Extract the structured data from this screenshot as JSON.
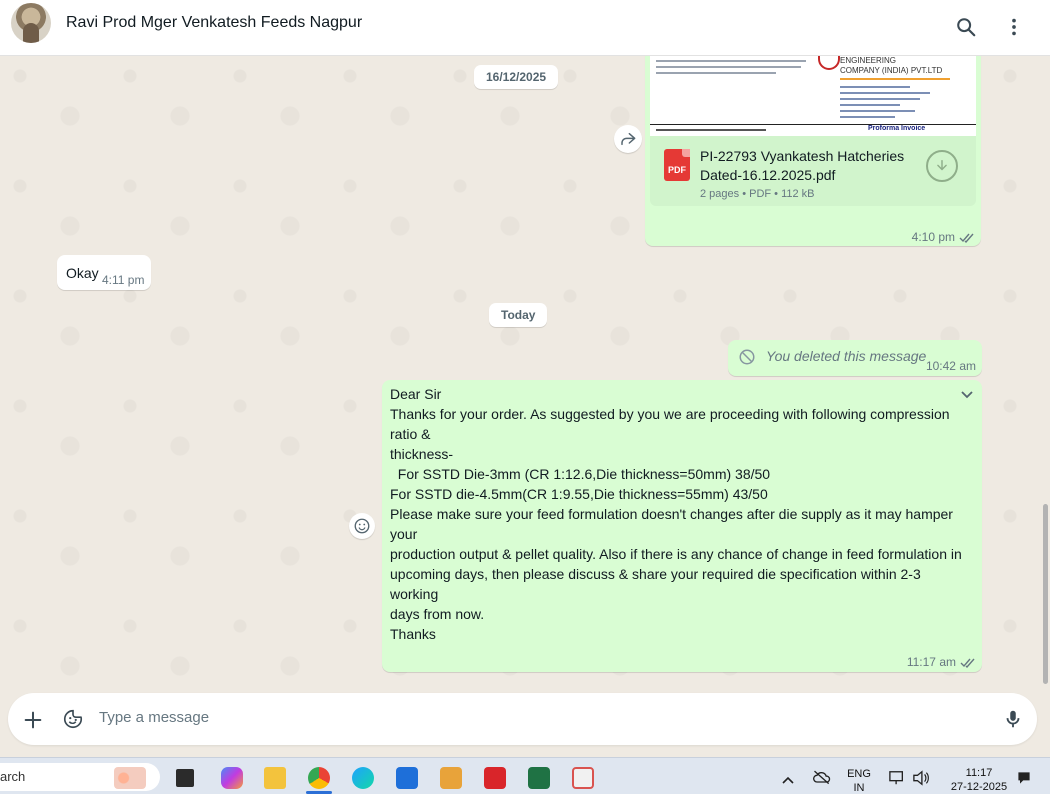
{
  "header": {
    "title": "Ravi Prod Mger Venkatesh Feeds Nagpur",
    "search_icon": "search-icon",
    "menu_icon": "more-vertical-icon"
  },
  "chat": {
    "date_1": "16/12/2025",
    "date_2": "Today",
    "doc_message": {
      "preview_company_line1": "ENGINEERING",
      "preview_company_line2": "COMPANY (INDIA) PVT.LTD",
      "preview_label": "Proforma Invoice",
      "file_name": "PI-22793 Vyankatesh Hatcheries Dated-16.12.2025.pdf",
      "file_info": "2 pages • PDF • 112 kB",
      "pdf_label": "PDF",
      "time": "4:10 pm"
    },
    "okay_message": {
      "text": "Okay",
      "time": "4:11 pm"
    },
    "deleted_message": {
      "text": "You deleted this message",
      "time": "10:42 am"
    },
    "long_message": {
      "lines": [
        "Dear Sir",
        "Thanks for your order. As suggested by you we are proceeding with following compression ratio &",
        "thickness-",
        "  For SSTD Die-3mm (CR 1:12.6,Die thickness=50mm) 38/50",
        "For SSTD die-4.5mm(CR 1:9.55,Die thickness=55mm) 43/50",
        "Please make sure your feed formulation doesn't changes after die supply as it may hamper your",
        "production output & pellet quality. Also if there is any chance of change in feed formulation in",
        "upcoming days, then please discuss & share your required die specification within 2-3 working",
        "days from now.",
        "Thanks"
      ],
      "time": "11:17 am"
    }
  },
  "composer": {
    "placeholder": "Type a message"
  },
  "taskbar": {
    "search_text": "arch",
    "lang_1": "ENG",
    "lang_2": "IN",
    "clock_time": "11:17",
    "clock_date": "27-12-2025"
  },
  "colors": {
    "outgoing": "#d9fdd3",
    "incoming": "#ffffff",
    "background": "#efeae2",
    "tick": "#667781"
  }
}
